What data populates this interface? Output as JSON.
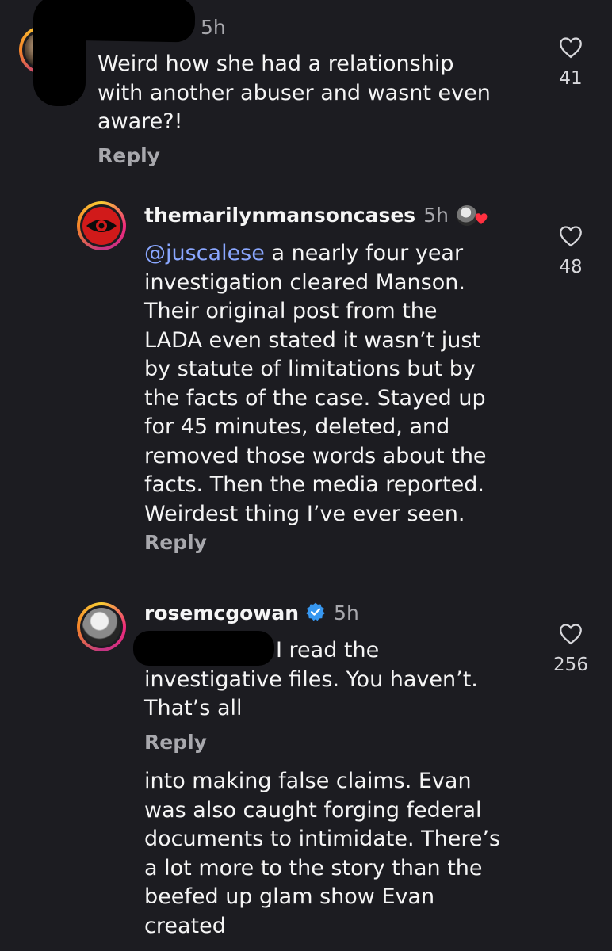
{
  "comments": [
    {
      "username": "",
      "time": "5h",
      "lines": [
        "Weird how she had a relationship",
        "with another abuser and wasnt even",
        "aware?!"
      ],
      "reply_label": "Reply",
      "likes": "41"
    },
    {
      "username": "themarilynmansoncases",
      "time": "5h",
      "mention": "@juscalese",
      "first_line_rest": " a nearly four year",
      "lines": [
        "investigation cleared Manson.",
        "Their original post from the",
        "LADA even stated it wasn’t just",
        "by statute of limitations but by",
        "the facts of the case. Stayed up",
        "for 45 minutes, deleted, and",
        "removed those words about the",
        "facts. Then the media reported.",
        "Weirdest thing I’ve ever seen."
      ],
      "reply_label": "Reply",
      "likes": "48",
      "liked_by_author_icon": "heart-icon"
    },
    {
      "username": "rosemcgowan",
      "verified": true,
      "time": "5h",
      "first_line_visible": "I read the",
      "lines": [
        "investigative  files. You haven’t.",
        "That’s all"
      ],
      "reply_label": "Reply",
      "likes": "256"
    }
  ],
  "continuation": {
    "lines": [
      "into making false claims. Evan",
      "was also caught forging federal",
      "documents to intimidate. There’s",
      "a lot more to the story than the",
      "beefed up glam show Evan",
      "created"
    ]
  },
  "icons": {
    "like": "heart-outline-icon",
    "verified": "verified-badge-icon"
  },
  "colors": {
    "background": "#1c1c21",
    "mention": "#8aa7ff",
    "verified": "#3797f0",
    "liked_heart": "#ff3040"
  }
}
